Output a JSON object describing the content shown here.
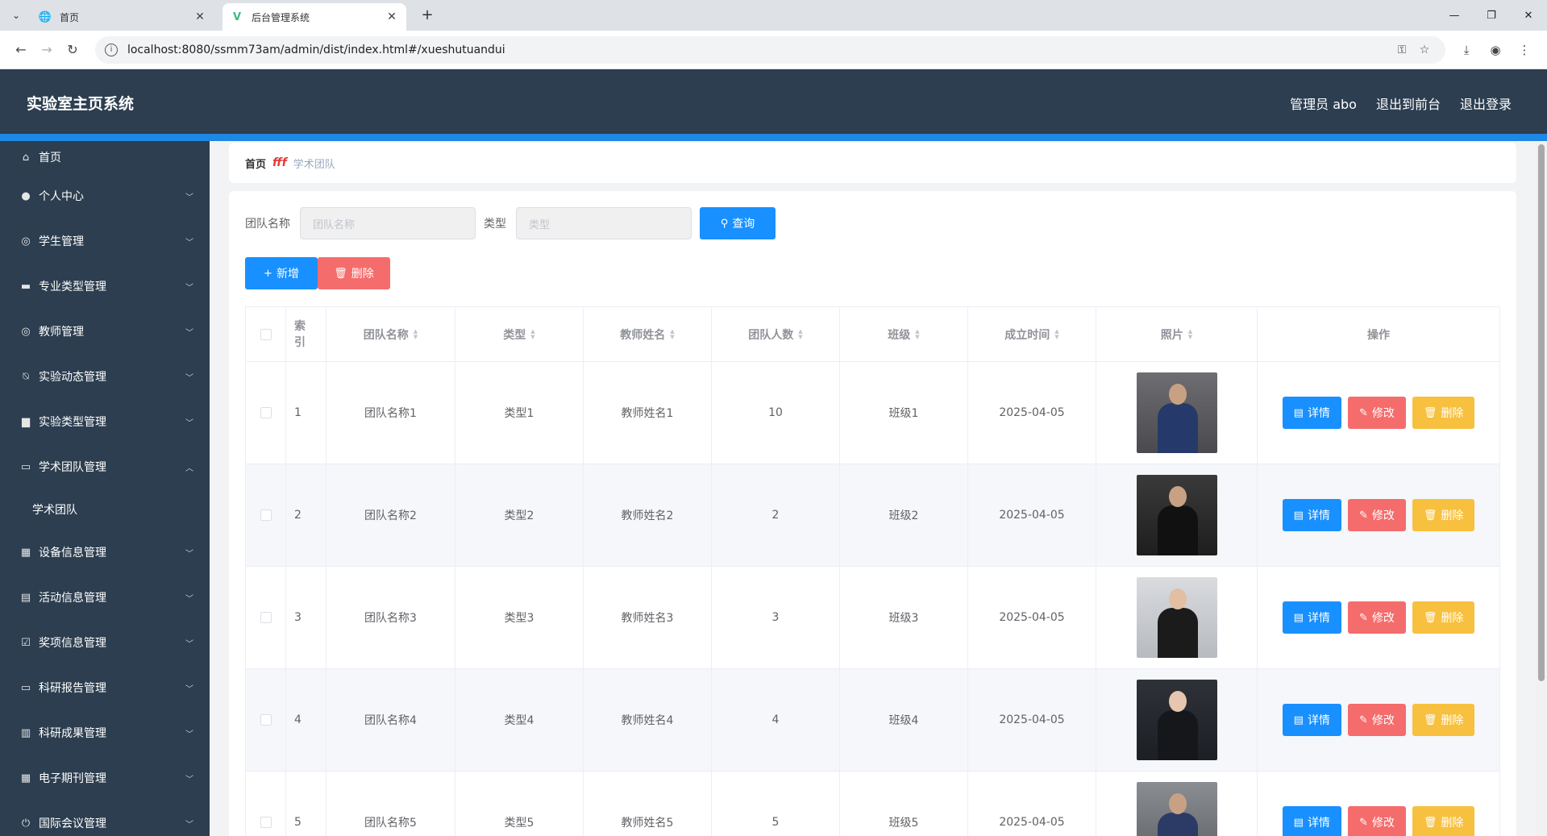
{
  "browser": {
    "tabs": [
      {
        "title": "首页",
        "icon": "globe-icon"
      },
      {
        "title": "后台管理系统",
        "icon": "vue-icon"
      }
    ],
    "url": "localhost:8080/ssmm73am/admin/dist/index.html#/xueshutuandui"
  },
  "header": {
    "brand": "实验室主页系统",
    "user": "管理员 abo",
    "to_front": "退出到前台",
    "logout": "退出登录"
  },
  "sidebar": {
    "items": [
      {
        "label": "首页",
        "icon": "home-icon"
      },
      {
        "label": "个人中心",
        "icon": "user-icon",
        "arrow": "⌄"
      },
      {
        "label": "学生管理",
        "icon": "compass-icon",
        "arrow": "⌄"
      },
      {
        "label": "专业类型管理",
        "icon": "chat-icon",
        "arrow": "⌄"
      },
      {
        "label": "教师管理",
        "icon": "target-icon",
        "arrow": "⌄"
      },
      {
        "label": "实验动态管理",
        "icon": "bell-off-icon",
        "arrow": "⌄"
      },
      {
        "label": "实验类型管理",
        "icon": "board-icon",
        "arrow": "⌄"
      },
      {
        "label": "学术团队管理",
        "icon": "message-icon",
        "arrow": "⌃"
      },
      {
        "label": "设备信息管理",
        "icon": "grid-icon",
        "arrow": "⌄"
      },
      {
        "label": "活动信息管理",
        "icon": "suitcase-icon",
        "arrow": "⌄"
      },
      {
        "label": "奖项信息管理",
        "icon": "checklist-icon",
        "arrow": "⌄"
      },
      {
        "label": "科研报告管理",
        "icon": "report-icon",
        "arrow": "⌄"
      },
      {
        "label": "科研成果管理",
        "icon": "doc-icon",
        "arrow": "⌄"
      },
      {
        "label": "电子期刊管理",
        "icon": "apps-icon",
        "arrow": "⌄"
      },
      {
        "label": "国际会议管理",
        "icon": "power-icon",
        "arrow": "⌄"
      }
    ],
    "submenu": "学术团队"
  },
  "breadcrumb": {
    "home": "首页",
    "sep": "fff",
    "current": "学术团队"
  },
  "search": {
    "team_label": "团队名称",
    "team_placeholder": "团队名称",
    "type_label": "类型",
    "type_placeholder": "类型",
    "query_button": "查询"
  },
  "actions": {
    "add": "新增",
    "delete": "删除"
  },
  "table": {
    "headers": {
      "index": "索引",
      "name": "团队名称",
      "type": "类型",
      "teacher": "教师姓名",
      "count": "团队人数",
      "class": "班级",
      "date": "成立时间",
      "photo": "照片",
      "ops": "操作"
    },
    "rows": [
      {
        "index": "1",
        "name": "团队名称1",
        "type": "类型1",
        "teacher": "教师姓名1",
        "count": "10",
        "class": "班级1",
        "date": "2025-04-05"
      },
      {
        "index": "2",
        "name": "团队名称2",
        "type": "类型2",
        "teacher": "教师姓名2",
        "count": "2",
        "class": "班级2",
        "date": "2025-04-05"
      },
      {
        "index": "3",
        "name": "团队名称3",
        "type": "类型3",
        "teacher": "教师姓名3",
        "count": "3",
        "class": "班级3",
        "date": "2025-04-05"
      },
      {
        "index": "4",
        "name": "团队名称4",
        "type": "类型4",
        "teacher": "教师姓名4",
        "count": "4",
        "class": "班级4",
        "date": "2025-04-05"
      },
      {
        "index": "5",
        "name": "团队名称5",
        "type": "类型5",
        "teacher": "教师姓名5",
        "count": "5",
        "class": "班级5",
        "date": "2025-04-05"
      }
    ],
    "row_buttons": {
      "detail": "详情",
      "edit": "修改",
      "delete": "删除"
    }
  },
  "colors": {
    "header_bg": "#2c3e50",
    "accent": "#1890ff",
    "danger": "#f56c6c",
    "warning": "#f7c03e"
  }
}
